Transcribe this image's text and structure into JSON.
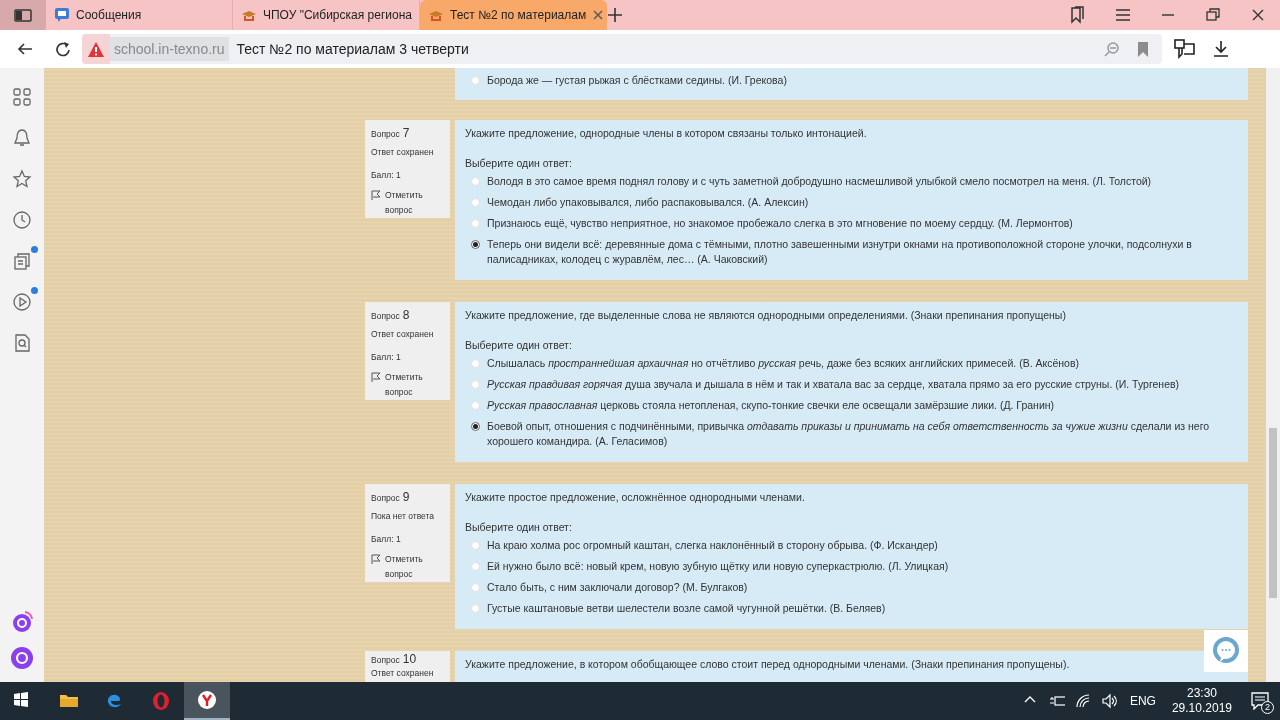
{
  "browser": {
    "tabs": [
      {
        "kind": "messages",
        "title": "Сообщения",
        "selected": false
      },
      {
        "kind": "site",
        "title": "ЧПОУ \"Сибирская региона",
        "selected": false
      },
      {
        "kind": "site",
        "title": "Тест №2 по материалам",
        "selected": true
      }
    ],
    "address": {
      "domain": "school.in-texno.ru",
      "title": "Тест №2 по материалам 3 четверти"
    }
  },
  "sidebar": {
    "items": [
      {
        "kind": "grid",
        "notification": false
      },
      {
        "kind": "bell",
        "notification": false
      },
      {
        "kind": "star",
        "notification": false
      },
      {
        "kind": "clock",
        "notification": false
      },
      {
        "kind": "cards",
        "notification": true
      },
      {
        "kind": "play",
        "notification": true
      },
      {
        "kind": "doc-search",
        "notification": false
      }
    ]
  },
  "previous_question": {
    "answers": [
      {
        "text": "Борода же — густая рыжая с блёстками седины. (И. Грекова)",
        "selected": false
      }
    ]
  },
  "questions": [
    {
      "label": "Вопрос",
      "number": "7",
      "status": "Ответ сохранен",
      "score": "Балл: 1",
      "flag": "Отметить вопрос",
      "text": "Укажите предложение, однородные члены в котором связаны только интонацией.",
      "prompt": "Выберите один ответ:",
      "answers": [
        {
          "text": "Володя в это самое время поднял голову и с чуть заметной добродушно насмешливой улыбкой смело посмотрел на меня. (Л. Толстой)",
          "selected": false
        },
        {
          "text": "Чемодан либо упаковывался, либо распаковывался. (А. Алексин)",
          "selected": false
        },
        {
          "text": "Признаюсь ещё, чувство неприятное, но знакомое пробежало слегка в это мгновение по моему сердцу. (М. Лермонтов)",
          "selected": false
        },
        {
          "text": "Теперь они видели всё: деревянные дома с тёмными, плотно завешенными изнутри окнами на противоположной стороне улочки, подсолнухи в палисадниках, колодец с журавлём, лес… (А. Чаковский)",
          "selected": true
        }
      ]
    },
    {
      "label": "Вопрос",
      "number": "8",
      "status": "Ответ сохранен",
      "score": "Балл: 1",
      "flag": "Отметить вопрос",
      "text": "Укажите предложение, где выделенные слова не являются однородными определениями. (Знаки препинания пропущены)",
      "prompt": "Выберите один ответ:",
      "answers": [
        {
          "text": "Слышалась *пространнейшая архаичная* но отчётливо *русская* речь, даже без всяких английских примесей. (В. Аксёнов)",
          "selected": false
        },
        {
          "text": "*Русская правдивая горячая* душа звучала и дышала в нём и так и хватала вас за сердце, хватала прямо за его русские струны. (И. Тургенев)",
          "selected": false
        },
        {
          "text": "*Русская православная* церковь стояла нетопленая, скупо-тонкие свечки еле освещали замёрзшие лики. (Д. Гранин)",
          "selected": false
        },
        {
          "text": "Боевой опыт, отношения с подчинёнными, привычка *отдавать приказы и принимать на себя ответственность за чужие жизни* сделали из него хорошего командира. (А. Геласимов)",
          "selected": true
        }
      ]
    },
    {
      "label": "Вопрос",
      "number": "9",
      "status": "Пока нет ответа",
      "score": "Балл: 1",
      "flag": "Отметить вопрос",
      "text": "Укажите простое предложение, осложнённое однородными членами.",
      "prompt": "Выберите один ответ:",
      "answers": [
        {
          "text": "На краю холма рос огромный каштан, слегка наклонённый в сторону обрыва. (Ф. Искандер)",
          "selected": false
        },
        {
          "text": "Ей нужно было всё: новый крем, новую зубную щётку или новую суперкастрюлю. (Л. Улицкая)",
          "selected": false
        },
        {
          "text": "Стало быть, с ним заключали договор? (М. Булгаков)",
          "selected": false
        },
        {
          "text": "Густые каштановые ветви шелестели возле самой чугунной решётки. (В. Беляев)",
          "selected": false
        }
      ]
    },
    {
      "label": "Вопрос",
      "number": "10",
      "status": "Ответ сохранен",
      "text": "Укажите предложение, в котором обобщающее слово стоит перед однородными членами. (Знаки препинания пропущены)."
    }
  ],
  "taskbar": {
    "language": "ENG",
    "time": "23:30",
    "date": "29.10.2019",
    "notifications": "2"
  }
}
